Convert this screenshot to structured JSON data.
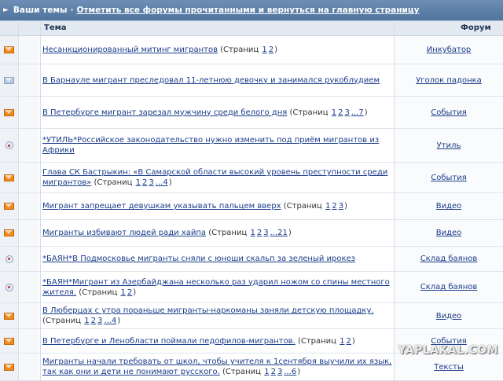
{
  "header": {
    "your_topics": "Ваши темы",
    "separator": "·",
    "mark_all_link": "Отметить все форумы прочитанными и вернуться на главную страницу"
  },
  "columns": {
    "topic": "Тема",
    "forum": "Форум"
  },
  "rows": [
    {
      "icon": "hot",
      "title": "Несанкционированный митинг мигрантов",
      "pages_label": "(Страниц",
      "pages": [
        "1",
        "2"
      ],
      "pages_close": ")",
      "forum": "Инкубатор"
    },
    {
      "icon": "cold",
      "title": "В Барнауле мигрант преследовал 11-летнюю девочку и занимался рукоблудием",
      "pages_label": "",
      "pages": [],
      "pages_close": "",
      "forum": "Уголок падонка"
    },
    {
      "icon": "hot",
      "title": "В Петербурге мигрант зарезал мужчину среди белого дня",
      "pages_label": "(Страниц",
      "pages": [
        "1",
        "2",
        "3",
        "...7"
      ],
      "pages_close": ")",
      "forum": "События"
    },
    {
      "icon": "pin",
      "title": "*УТИЛЬ*Российское законодательство нужно изменить под приём мигрантов из Африки",
      "pages_label": "",
      "pages": [],
      "pages_close": "",
      "forum": "Утиль"
    },
    {
      "icon": "hot",
      "title": "Глава СК Бастрыкин: «В Самарской области высокий уровень преступности среди мигрантов»",
      "pages_label": "(Страниц",
      "pages": [
        "1",
        "2",
        "3",
        "...4"
      ],
      "pages_close": ")",
      "forum": "События"
    },
    {
      "icon": "hot",
      "title": "Мигрант запрещает девушкам указывать пальцем вверх",
      "pages_label": "(Страниц",
      "pages": [
        "1",
        "2",
        "3"
      ],
      "pages_close": ")",
      "forum": "Видео"
    },
    {
      "icon": "hot",
      "title": "Мигранты избивают людей ради хайпа",
      "pages_label": "(Страниц",
      "pages": [
        "1",
        "2",
        "3",
        "...21"
      ],
      "pages_close": ")",
      "forum": "Видео"
    },
    {
      "icon": "pin",
      "title": "*БАЯН*В Подмосковье мигранты сняли с юноши скальп за зеленый ирокез",
      "pages_label": "",
      "pages": [],
      "pages_close": "",
      "forum": "Склад баянов"
    },
    {
      "icon": "pin",
      "title": "*БАЯН*Мигрант из Азербайджана несколько раз ударил ножом со спины местного жителя.",
      "pages_label": "(Страниц",
      "pages": [
        "1",
        "2"
      ],
      "pages_close": ")",
      "forum": "Склад баянов"
    },
    {
      "icon": "hot",
      "title": "В Люберцах с утра пораньше мигранты-наркоманы заняли детскую площадку.",
      "pages_label": "(Страниц",
      "pages": [
        "1",
        "2",
        "3",
        "...4"
      ],
      "pages_close": ")",
      "forum": "Видео"
    },
    {
      "icon": "hot",
      "title": "В Петербурге и Ленобласти поймали педофилов-мигрантов.",
      "pages_label": "(Страниц",
      "pages": [
        "1",
        "2"
      ],
      "pages_close": ")",
      "forum": "События"
    },
    {
      "icon": "hot",
      "title": "Мигранты начали требовать от школ, чтобы учителя к 1сентября выучили их язык, так как они и дети не понимают русского.",
      "pages_label": "(Страниц",
      "pages": [
        "1",
        "2",
        "3",
        "...6"
      ],
      "pages_close": ")",
      "forum": "Тексты"
    }
  ],
  "watermark": "YAPLAKAL.COM"
}
